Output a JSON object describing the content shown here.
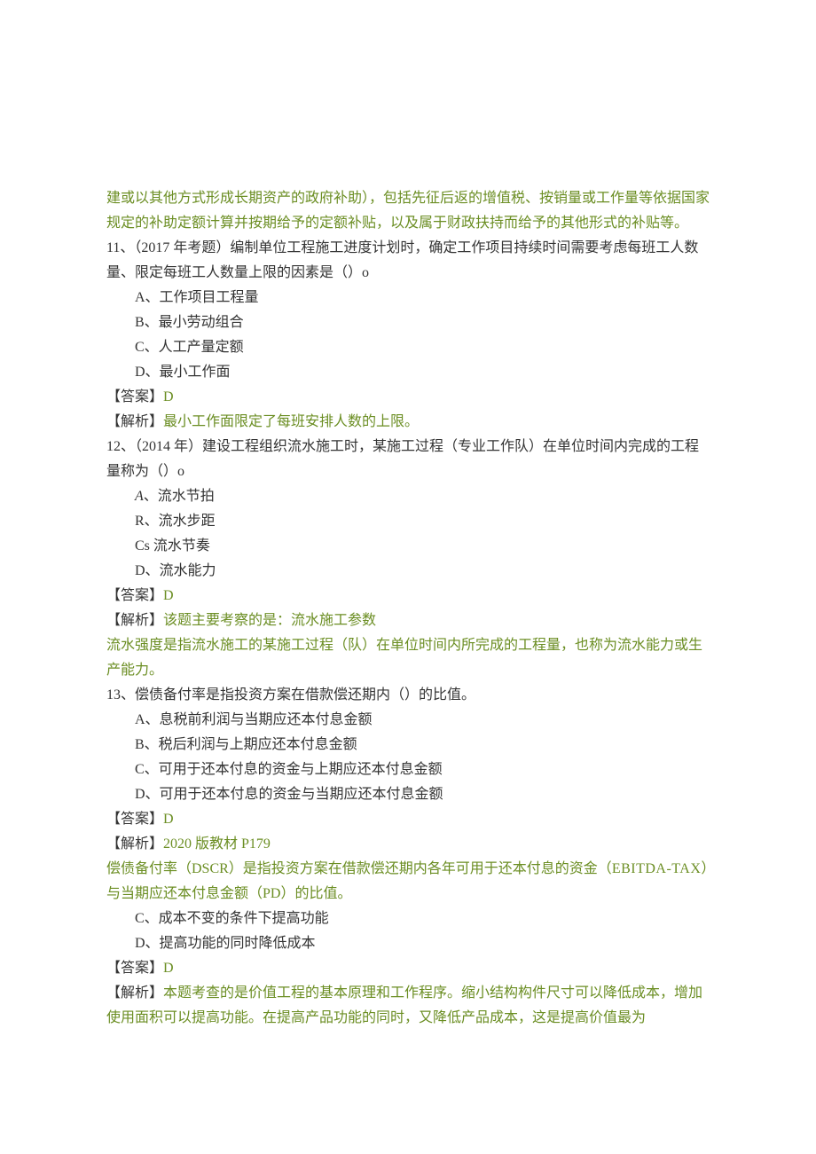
{
  "intro": {
    "text": "建或以其他方式形成长期资产的政府补助），包括先征后返的增值税、按销量或工作量等依据国家规定的补助定额计算并按期给予的定额补贴，以及属于财政扶持而给予的其他形式的补贴等。"
  },
  "q11": {
    "stem": "11、（2017 年考题）编制单位工程施工进度计划时，确定工作项目持续时间需要考虑每班工人数量、限定每班工人数量上限的因素是（）o",
    "opts": {
      "A": "A、工作项目工程量",
      "B": "B、最小劳动组合",
      "C": "C、人工产量定额",
      "D": "D、最小工作面"
    },
    "ans_label": "【答案】",
    "ans_value": "D",
    "exp_label": "【解析】",
    "exp_body": "最小工作面限定了每班安排人数的上限。"
  },
  "q12": {
    "stem": "12、（2014 年）建设工程组织流水施工时，某施工过程（专业工作队）在单位时间内完成的工程量称为（）o",
    "opts": {
      "A": "A、流水节拍",
      "B": "R、流水步距",
      "C": "Cs 流水节奏",
      "D": "D、流水能力"
    },
    "ans_label": "【答案】",
    "ans_value": "D",
    "exp_label": "【解析】",
    "exp_body1": "该题主要考察的是：流水施工参数",
    "exp_body2": "流水强度是指流水施工的某施工过程（队）在单位时间内所完成的工程量，也称为流水能力或生产能力。"
  },
  "q13": {
    "stem": "13、偿债备付率是指投资方案在借款偿还期内（）的比值。",
    "opts": {
      "A": "A、息税前利润与当期应还本付息金额",
      "B": "B、税后利润与上期应还本付息金额",
      "C": "C、可用于还本付息的资金与上期应还本付息金额",
      "D": "D、可用于还本付息的资金与当期应还本付息金额"
    },
    "ans_label": "【答案】",
    "ans_value": "D",
    "exp_label": "【解析】",
    "exp_body1": "2020 版教材 P179",
    "exp_body2_a": "偿债备付率（DSCR）是指投资方案在借款偿还期内各年可用于还本付息的资金（",
    "exp_body2_b": "EBITDA-TAX",
    "exp_body2_c": "）与当期应还本付息金额（PD）的比值。"
  },
  "q14": {
    "opts": {
      "C": "C、成本不变的条件下提高功能",
      "D": "D、提高功能的同时降低成本"
    },
    "ans_label": "【答案】",
    "ans_value": "D",
    "exp_label": "【解析】",
    "exp_body": "本题考查的是价值工程的基本原理和工作程序。缩小结构构件尺寸可以降低成本，增加使用面积可以提高功能。在提高产品功能的同时，又降低产品成本，这是提高价值最为"
  }
}
